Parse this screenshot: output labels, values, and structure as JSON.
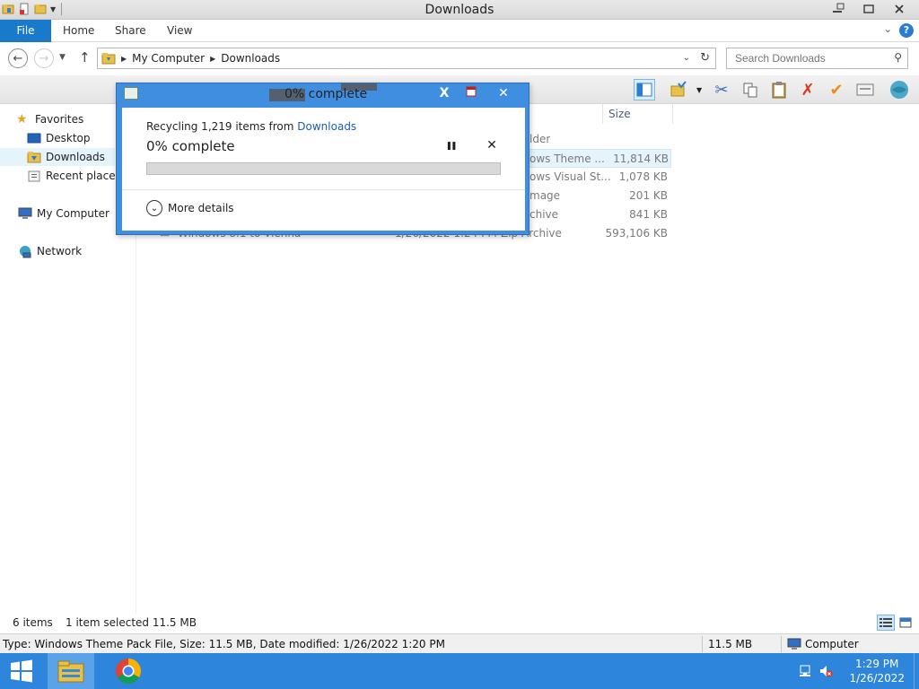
{
  "window": {
    "title": "Downloads"
  },
  "ribbon": {
    "tabs": [
      "File",
      "Home",
      "Share",
      "View"
    ]
  },
  "address": {
    "crumbs": [
      "My Computer",
      "Downloads"
    ]
  },
  "search": {
    "placeholder": "Search Downloads"
  },
  "nav": {
    "favorites": "Favorites",
    "desktop": "Desktop",
    "downloads": "Downloads",
    "recent": "Recent places",
    "computer": "My Computer",
    "network": "Network"
  },
  "filelist": {
    "headers": {
      "type": "",
      "size": "Size"
    },
    "rows": [
      {
        "name": "",
        "date": "",
        "type": "lder",
        "size": ""
      },
      {
        "name": "",
        "date": "",
        "type": "ows Theme ...",
        "size": "11,814 KB"
      },
      {
        "name": "",
        "date": "",
        "type": "ows Visual St...",
        "size": "1,078 KB"
      },
      {
        "name": "",
        "date": "",
        "type": "mage",
        "size": "201 KB"
      },
      {
        "name": "",
        "date": "",
        "type": "chive",
        "size": "841 KB"
      },
      {
        "name": "Windows 8.1 to Vienna - v1.0",
        "date": "1/26/2022 1:24 PM",
        "type": "Zip Archive",
        "size": "593,106 KB"
      }
    ]
  },
  "dialog": {
    "title": "0% complete",
    "line_prefix": "Recycling 1,219 items from ",
    "line_link": "Downloads",
    "percent_text": "0% complete",
    "progress": 0,
    "more_details": "More details",
    "pause_glyph": "❚❚",
    "stop_glyph": "✕"
  },
  "status": {
    "items": "6 items",
    "selected": "1 item selected  11.5 MB"
  },
  "details": {
    "info": "Type: Windows Theme Pack File, Size: 11.5 MB, Date modified: 1/26/2022 1:20 PM",
    "size": "11.5 MB",
    "location": "Computer"
  },
  "taskbar": {
    "time": "1:29 PM",
    "date": "1/26/2022"
  },
  "colors": {
    "accent": "#1979ca",
    "taskbar": "#2d86dc",
    "dialog_frame": "#3f8ee0",
    "link": "#1a5fb4"
  }
}
